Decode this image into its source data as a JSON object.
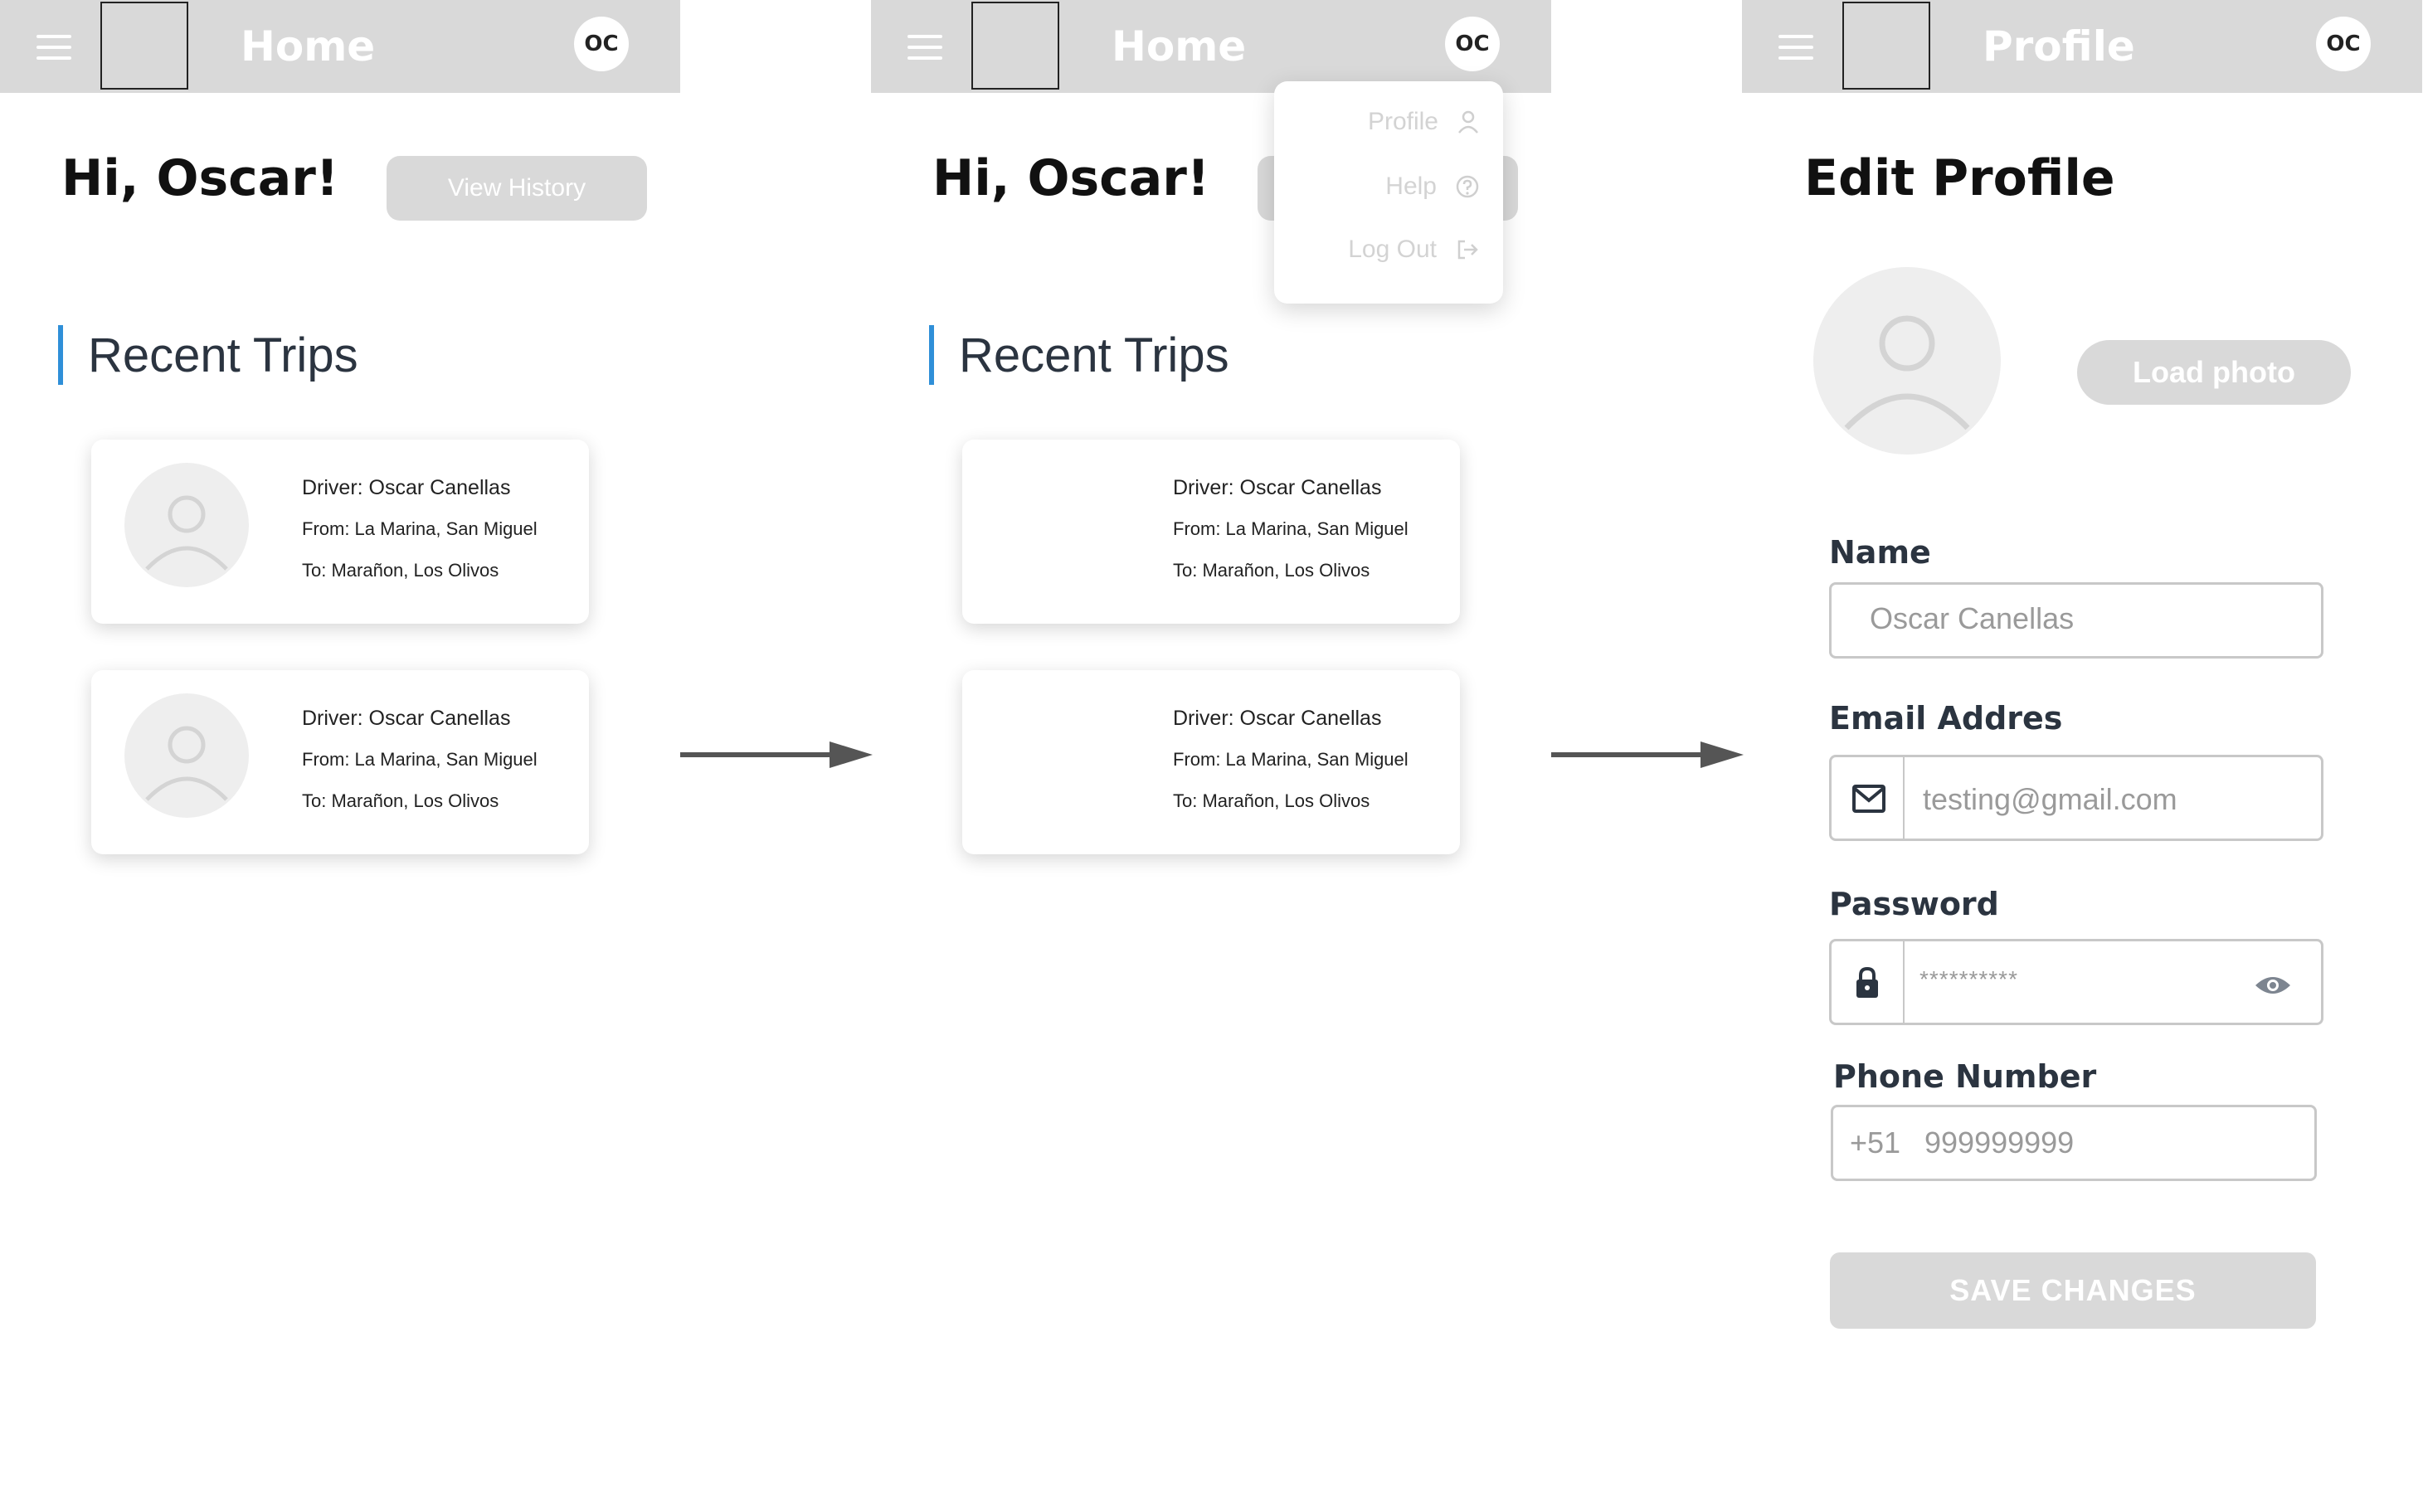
{
  "screens": [
    {
      "topbar": {
        "title": "Home",
        "avatar_initials": "OC"
      },
      "greeting": "Hi, Oscar!",
      "view_history_label": "View History",
      "section_title": "Recent Trips",
      "trips": [
        {
          "driver": "Driver: Oscar Canellas",
          "from": "From: La Marina, San Miguel",
          "to": "To: Marañon, Los Olivos"
        },
        {
          "driver": "Driver: Oscar Canellas",
          "from": "From: La Marina, San Miguel",
          "to": "To: Marañon, Los Olivos"
        }
      ]
    },
    {
      "topbar": {
        "title": "Home",
        "avatar_initials": "OC"
      },
      "greeting": "Hi, Oscar!",
      "section_title": "Recent Trips",
      "menu": [
        {
          "label": "Profile",
          "icon": "user-icon"
        },
        {
          "label": "Help",
          "icon": "help-circle-icon"
        },
        {
          "label": "Log Out",
          "icon": "logout-icon"
        }
      ],
      "trips": [
        {
          "driver": "Driver: Oscar Canellas",
          "from": "From: La Marina, San Miguel",
          "to": "To: Marañon, Los Olivos"
        },
        {
          "driver": "Driver: Oscar Canellas",
          "from": "From: La Marina, San Miguel",
          "to": "To: Marañon, Los Olivos"
        }
      ]
    },
    {
      "topbar": {
        "title": "Profile",
        "avatar_initials": "OC"
      },
      "page_title": "Edit Profile",
      "load_photo_label": "Load photo",
      "fields": {
        "name": {
          "label": "Name",
          "value": "Oscar Canellas"
        },
        "email": {
          "label": "Email Addres",
          "value": "testing@gmail.com",
          "icon": "mail-icon"
        },
        "password": {
          "label": "Password",
          "value": "**********",
          "icon": "lock-icon",
          "toggle_icon": "eye-icon"
        },
        "phone": {
          "label": "Phone Number",
          "prefix": "+51",
          "value": "999999999"
        }
      },
      "save_label": "SAVE CHANGES"
    }
  ],
  "colors": {
    "bar": "#d9d9d9",
    "accent": "#2f8fd8",
    "button": "#d9d9d9"
  }
}
